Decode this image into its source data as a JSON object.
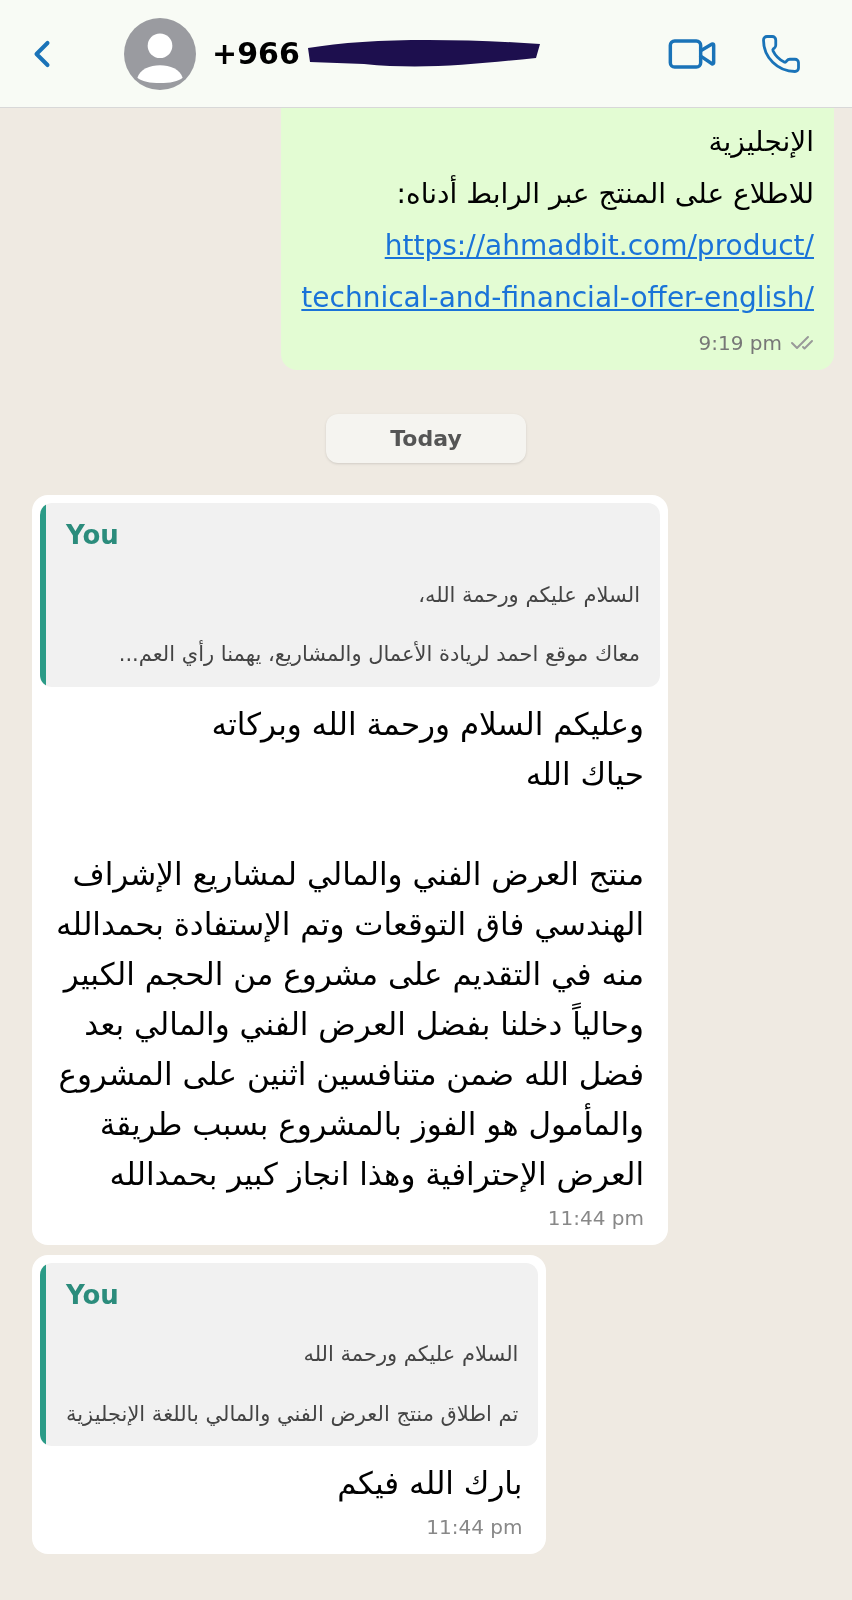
{
  "header": {
    "contact": "+966"
  },
  "messages": [
    {
      "kind": "outgoing",
      "text": "الإنجليزية\nللاطلاع على المنتج عبر الرابط أدناه:",
      "link": "https://ahmadbit.com/product/\ntechnical-and-financial-offer-english/",
      "time": "9:19 pm",
      "read": false
    },
    {
      "kind": "date",
      "text": "Today"
    },
    {
      "kind": "incoming",
      "quote": {
        "author": "You",
        "lines": [
          "السلام عليكم ورحمة الله،",
          "معاك موقع احمد لريادة الأعمال والمشاريع، يهمنا رأي العم..."
        ]
      },
      "text": "وعليكم السلام ورحمة الله وبركاته\nحياك الله\n\nمنتج العرض الفني والمالي لمشاريع الإشراف\nالهندسي فاق التوقعات وتم الإستفادة بحمدالله\nمنه في التقديم على مشروع من الحجم الكبير\nوحالياً دخلنا بفضل العرض الفني والمالي بعد\nفضل الله ضمن متنافسين اثنين على المشروع\nوالمأمول هو الفوز بالمشروع بسبب طريقة\nالعرض الإحترافية وهذا انجاز كبير بحمدالله",
      "time": "11:44 pm"
    },
    {
      "kind": "incoming",
      "quote": {
        "author": "You",
        "lines": [
          "السلام عليكم ورحمة الله",
          "تم اطلاق منتج العرض الفني والمالي باللغة الإنجليزية"
        ]
      },
      "text": "بارك الله فيكم",
      "time": "11:44 pm"
    }
  ]
}
